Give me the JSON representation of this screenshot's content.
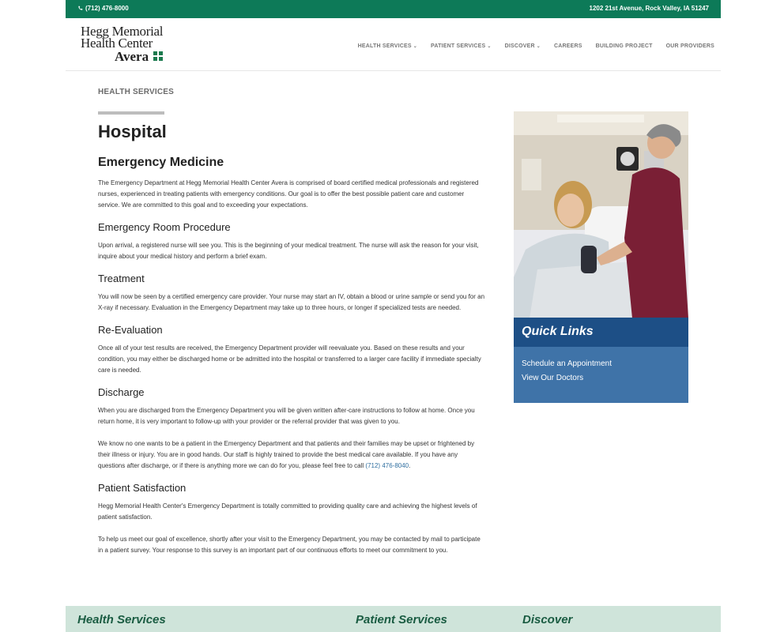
{
  "topbar": {
    "phone": "(712) 476-8000",
    "address": "1202 21st Avenue, Rock Valley, IA 51247"
  },
  "logo": {
    "line1": "Hegg Memorial",
    "line2": "Health Center",
    "line3": "Avera"
  },
  "nav": [
    {
      "label": "HEALTH SERVICES",
      "caret": true
    },
    {
      "label": "PATIENT SERVICES",
      "caret": true
    },
    {
      "label": "DISCOVER",
      "caret": true
    },
    {
      "label": "CAREERS",
      "caret": false
    },
    {
      "label": "BUILDING PROJECT",
      "caret": false
    },
    {
      "label": "OUR PROVIDERS",
      "caret": false
    }
  ],
  "breadcrumb": "HEALTH SERVICES",
  "page_title": "Hospital",
  "main": {
    "heading": "Emergency Medicine",
    "intro": "The Emergency Department at Hegg Memorial Health Center Avera is comprised of board certified medical professionals and registered nurses, experienced in treating patients with emergency conditions. Our goal is to offer the best possible patient care and customer service. We are committed to this goal and to exceeding your expectations.",
    "sections": [
      {
        "title": "Emergency Room Procedure",
        "paras": [
          "Upon arrival, a registered nurse will see you. This is the beginning of your medical treatment. The nurse will ask the reason for your visit, inquire about your medical history and perform a brief exam."
        ]
      },
      {
        "title": "Treatment",
        "paras": [
          "You will now be seen by a certified emergency care provider. Your nurse may start an IV, obtain a blood or urine sample or send you for an X-ray if necessary. Evaluation in the Emergency Department may take up to three hours, or longer if specialized tests are needed."
        ]
      },
      {
        "title": "Re-Evaluation",
        "paras": [
          "Once all of your test results are received, the Emergency Department provider will reevaluate you. Based on these results and your condition, you may either be discharged home or be admitted into the hospital or transferred to a larger care facility if immediate specialty care is needed."
        ]
      },
      {
        "title": "Discharge",
        "paras": [
          "When you are discharged from the Emergency Department you will be given written after-care instructions to follow at home. Once you return home, it is very important to follow-up with your provider or the referral provider that was given to you.",
          "We know no one wants to be a patient in the Emergency Department and that patients and their families may be upset or frightened by their illness or injury. You are in good hands. Our staff is highly trained to provide the best medical care available. If you have any questions after discharge, or if there is anything more we can do for you, please feel free to call"
        ]
      },
      {
        "title": "Patient Satisfaction",
        "paras": [
          "Hegg Memorial Health Center's Emergency Department is totally committed to providing quality care and achieving the highest levels of patient satisfaction.",
          "To help us meet our goal of excellence, shortly after your visit to the Emergency Department, you may be contacted by mail to participate in a patient survey. Your response to this survey is an important part of our continuous efforts to meet our commitment to you."
        ]
      }
    ],
    "call_phone": "(712) 476-8040"
  },
  "quick_links": {
    "title": "Quick Links",
    "items": [
      "Schedule an Appointment",
      "View Our Doctors"
    ]
  },
  "footer": {
    "col1": "Health Services",
    "col2": "Patient Services",
    "col3": "Discover"
  },
  "colors": {
    "top_green": "#0d7a58",
    "ql_dark": "#1d4f86",
    "ql_blue": "#3f73a8",
    "footer_bg": "#cfe4da"
  }
}
